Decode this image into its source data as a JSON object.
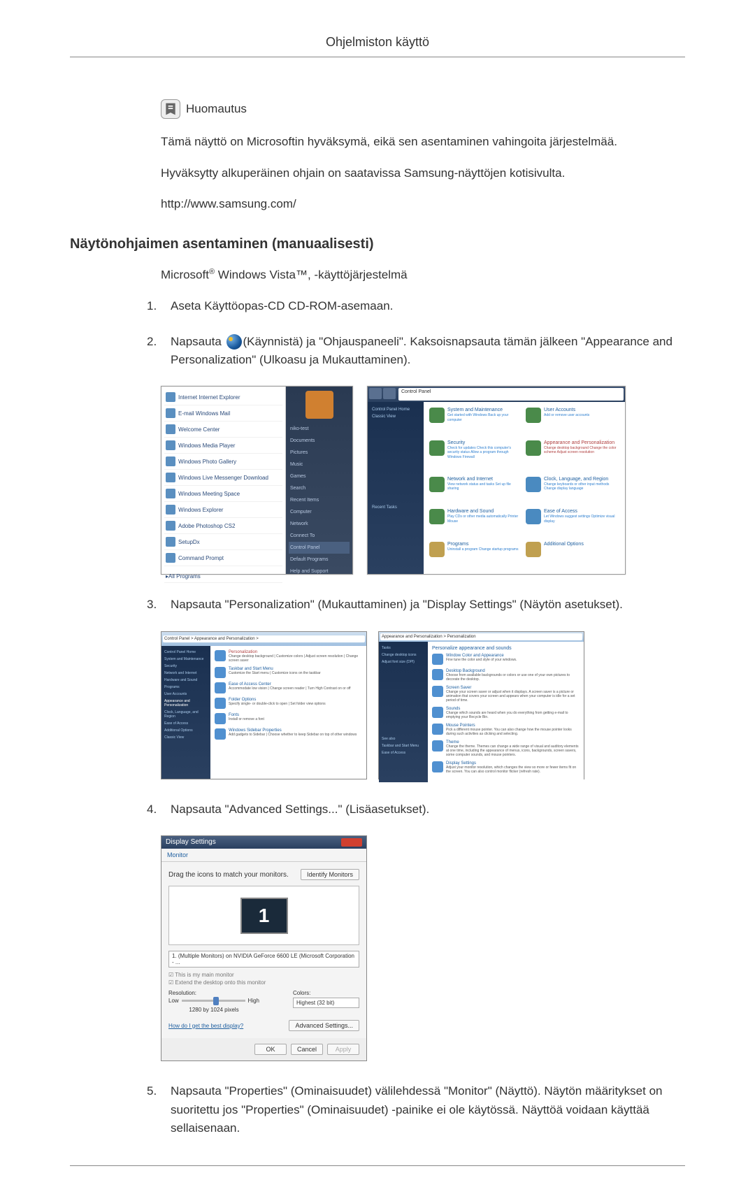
{
  "page_title": "Ohjelmiston käyttö",
  "note": {
    "label": "Huomautus",
    "line1": "Tämä näyttö on Microsoftin hyväksymä, eikä sen asentaminen vahingoita järjestelmää.",
    "line2": "Hyväksytty alkuperäinen ohjain on saatavissa Samsung-näyttöjen kotisivulta.",
    "url": "http://www.samsung.com/"
  },
  "heading": "Näytönohjaimen asentaminen (manuaalisesti)",
  "subheading_prefix": "Microsoft",
  "subheading_reg": "®",
  "subheading_mid": " Windows Vista™",
  "subheading_suffix": ", -käyttöjärjestelmä",
  "steps": {
    "s1": "Aseta Käyttöopas-CD CD-ROM-asemaan.",
    "s2a": "Napsauta ",
    "s2b": "(Käynnistä) ja \"Ohjauspaneeli\". Kaksoisnapsauta tämän jälkeen \"Appearance and Personalization\" (Ulkoasu ja Mukauttaminen).",
    "s3": "Napsauta \"Personalization\" (Mukauttaminen) ja \"Display Settings\" (Näytön asetukset).",
    "s4": "Napsauta \"Advanced Settings...\" (Lisäasetukset).",
    "s5": "Napsauta \"Properties\" (Ominaisuudet) välilehdessä \"Monitor\" (Näyttö). Näytön määritykset on suoritettu jos \"Properties\" (Ominaisuudet) -painike ei ole käytössä. Näyttöä voidaan käyttää sellaisenaan."
  },
  "nums": {
    "n1": "1.",
    "n2": "2.",
    "n3": "3.",
    "n4": "4.",
    "n5": "5."
  },
  "start_menu": {
    "items": [
      "Internet\nInternet Explorer",
      "E-mail\nWindows Mail",
      "Welcome Center",
      "Windows Media Player",
      "Windows Photo Gallery",
      "Windows Live Messenger Download",
      "Windows Meeting Space",
      "Windows Explorer",
      "Adobe Photoshop CS2",
      "SetupDx",
      "Command Prompt"
    ],
    "all_programs": "All Programs",
    "right": [
      "niko-test",
      "Documents",
      "Pictures",
      "Music",
      "Games",
      "Search",
      "Recent Items",
      "Computer",
      "Network",
      "Connect To",
      "Control Panel",
      "Default Programs",
      "Help and Support"
    ]
  },
  "control_panel": {
    "address": "Control Panel",
    "side": [
      "Control Panel Home",
      "Classic View"
    ],
    "tasks": "Recent Tasks",
    "cats": [
      {
        "t": "System and Maintenance",
        "s": "Get started with Windows\nBack up your computer"
      },
      {
        "t": "User Accounts",
        "s": "Add or remove user accounts"
      },
      {
        "t": "Security",
        "s": "Check for updates\nCheck this computer's security status\nAllow a program through Windows Firewall"
      },
      {
        "t": "Appearance and Personalization",
        "s": "Change desktop background\nChange the color scheme\nAdjust screen resolution",
        "hilite": true
      },
      {
        "t": "Network and Internet",
        "s": "View network status and tasks\nSet up file sharing"
      },
      {
        "t": "Clock, Language, and Region",
        "s": "Change keyboards or other input methods\nChange display language"
      },
      {
        "t": "Hardware and Sound",
        "s": "Play CDs or other media automatically\nPrinter\nMouse"
      },
      {
        "t": "Ease of Access",
        "s": "Let Windows suggest settings\nOptimize visual display"
      },
      {
        "t": "Programs",
        "s": "Uninstall a program\nChange startup programs"
      },
      {
        "t": "Additional Options",
        "s": ""
      }
    ]
  },
  "appearance_panel": {
    "address": "Control Panel > Appearance and Personalization >",
    "side": [
      "Control Panel Home",
      "System and Maintenance",
      "Security",
      "Network and Internet",
      "Hardware and Sound",
      "Programs",
      "User Accounts",
      "Appearance and Personalization",
      "Clock, Language, and Region",
      "Ease of Access",
      "Additional Options",
      "",
      "Classic View"
    ],
    "entries": [
      {
        "t": "Personalization",
        "s": "Change desktop background | Customize colors | Adjust screen resolution | Change screen saver"
      },
      {
        "t": "Taskbar and Start Menu",
        "s": "Customize the Start menu | Customize icons on the taskbar"
      },
      {
        "t": "Ease of Access Center",
        "s": "Accommodate low vision | Change screen reader | Turn High Contrast on or off"
      },
      {
        "t": "Folder Options",
        "s": "Specify single- or double-click to open | Set folder view options"
      },
      {
        "t": "Fonts",
        "s": "Install or remove a font"
      },
      {
        "t": "Windows Sidebar Properties",
        "s": "Add gadgets to Sidebar | Choose whether to keep Sidebar on top of other windows"
      }
    ]
  },
  "personalization_panel": {
    "address": "Appearance and Personalization > Personalization",
    "title": "Personalize appearance and sounds",
    "side": [
      "Tasks",
      "Change desktop icons",
      "Adjust font size (DPI)"
    ],
    "entries": [
      {
        "t": "Window Color and Appearance",
        "s": "Fine tune the color and style of your windows."
      },
      {
        "t": "Desktop Background",
        "s": "Choose from available backgrounds or colors or use one of your own pictures to decorate the desktop."
      },
      {
        "t": "Screen Saver",
        "s": "Change your screen saver or adjust when it displays. A screen saver is a picture or animation that covers your screen and appears when your computer is idle for a set period of time."
      },
      {
        "t": "Sounds",
        "s": "Change which sounds are heard when you do everything from getting e-mail to emptying your Recycle Bin."
      },
      {
        "t": "Mouse Pointers",
        "s": "Pick a different mouse pointer. You can also change how the mouse pointer looks during such activities as clicking and selecting."
      },
      {
        "t": "Theme",
        "s": "Change the theme. Themes can change a wide range of visual and auditory elements at one time, including the appearance of menus, icons, backgrounds, screen savers, some computer sounds, and mouse pointers."
      },
      {
        "t": "Display Settings",
        "s": "Adjust your monitor resolution, which changes the view so more or fewer items fit on the screen. You can also control monitor flicker (refresh rate)."
      }
    ],
    "see_also": "See also",
    "see_items": [
      "Taskbar and Start Menu",
      "Ease of Access"
    ]
  },
  "display_settings": {
    "title": "Display Settings",
    "tab": "Monitor",
    "drag_text": "Drag the icons to match your monitors.",
    "identify": "Identify Monitors",
    "monitor_num": "1",
    "dropdown": "1. (Multiple Monitors) on NVIDIA GeForce 6600 LE (Microsoft Corporation - ...",
    "check1": "This is my main monitor",
    "check2": "Extend the desktop onto this monitor",
    "resolution_label": "Resolution:",
    "low": "Low",
    "high": "High",
    "resolution_value": "1280 by 1024 pixels",
    "colors_label": "Colors:",
    "colors_value": "Highest (32 bit)",
    "help_link": "How do I get the best display?",
    "advanced": "Advanced Settings...",
    "ok": "OK",
    "cancel": "Cancel",
    "apply": "Apply"
  }
}
